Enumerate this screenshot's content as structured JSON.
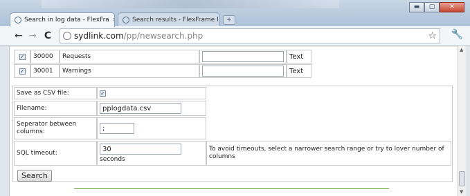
{
  "window": {
    "minimize_label": "▬",
    "maximize_label": "▢",
    "close_label": "✕"
  },
  "tabs": [
    {
      "label": "Search in log data - FlexFra",
      "close": "×"
    },
    {
      "label": "Search results - FlexFrame I",
      "close": "×"
    }
  ],
  "toolbar": {
    "back": "←",
    "forward": "→",
    "reload": "C",
    "url_host": "sydlink.com",
    "url_path": "/pp/newsearch.php",
    "star": "☆",
    "wrench": "🔧"
  },
  "data_rows": [
    {
      "checked": "✓",
      "id": "30000",
      "name": "Requests",
      "value": "",
      "type": "Text"
    },
    {
      "checked": "✓",
      "id": "30001",
      "name": "Warnings",
      "value": "",
      "type": "Text"
    }
  ],
  "form": {
    "save_csv_label": "Save as CSV file:",
    "save_csv_checked": "✓",
    "filename_label": "Filename:",
    "filename_value": "pplogdata.csv",
    "separator_label": "Seperator between columns:",
    "separator_value": ";",
    "sql_timeout_label": "SQL timeout:",
    "sql_timeout_value": "30",
    "sql_timeout_unit": "seconds",
    "sql_timeout_hint": "To avoid timeouts, select a narrower search range or try to lover number of columns"
  },
  "search_button": "Search"
}
